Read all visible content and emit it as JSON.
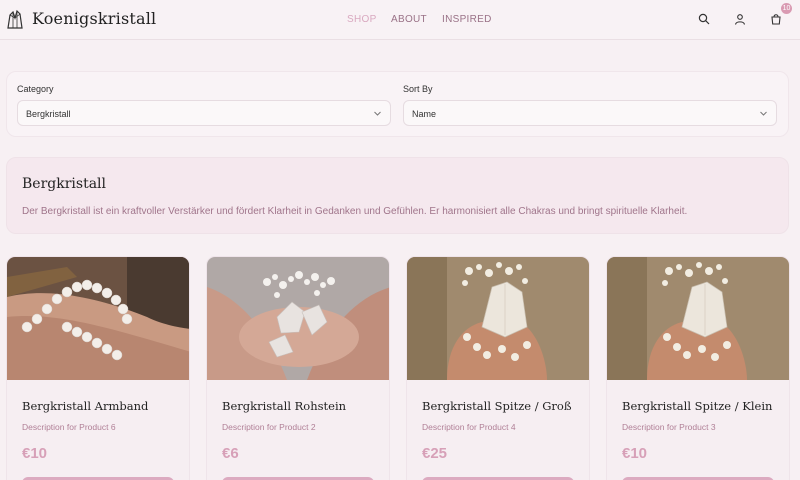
{
  "header": {
    "brand": "Koenigskristall",
    "logo_icon": "crystal-icon",
    "nav": [
      {
        "label": "SHOP",
        "active": true
      },
      {
        "label": "ABOUT",
        "active": false
      },
      {
        "label": "INSPIRED",
        "active": false
      }
    ],
    "icons": [
      "search-icon",
      "user-icon",
      "cart-icon"
    ],
    "cart_count": "10"
  },
  "filters": {
    "category": {
      "label": "Category",
      "value": "Bergkristall"
    },
    "sort": {
      "label": "Sort By",
      "value": "Name"
    }
  },
  "category_info": {
    "title": "Bergkristall",
    "description": "Der Bergkristall ist ein kraftvoller Verstärker und fördert Klarheit in Gedanken und Gefühlen. Er harmonisiert alle Chakras und bringt spirituelle Klarheit."
  },
  "products": [
    {
      "title": "Bergkristall Armband",
      "description": "Description for Product 6",
      "price": "€10"
    },
    {
      "title": "Bergkristall Rohstein",
      "description": "Description for Product 2",
      "price": "€6"
    },
    {
      "title": "Bergkristall Spitze / Groß",
      "description": "Description for Product 4",
      "price": "€25"
    },
    {
      "title": "Bergkristall Spitze / Klein",
      "description": "Description for Product 3",
      "price": "€10"
    }
  ],
  "colors": {
    "accent": "#d9a9c0",
    "nav_text": "#9a7287",
    "description_text": "#a0758b",
    "price": "#d7a0b8",
    "background": "#f7f0f3"
  }
}
